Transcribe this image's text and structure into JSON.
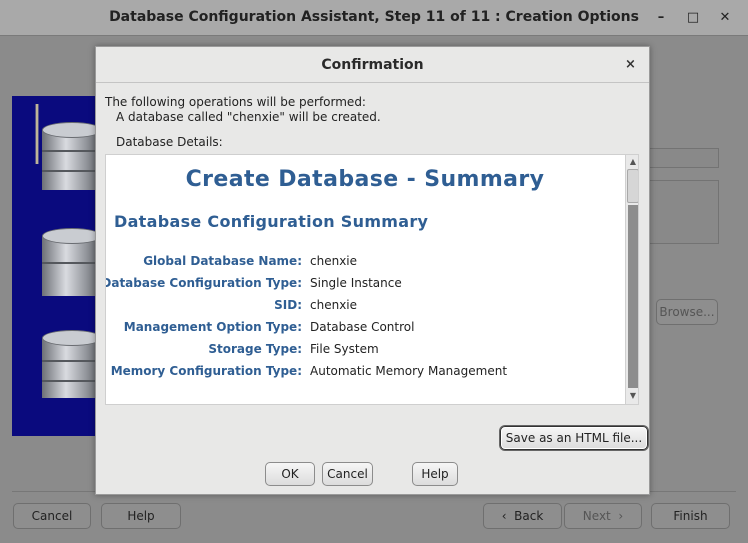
{
  "window": {
    "title": "Database Configuration Assistant, Step 11 of 11 : Creation Options",
    "minimize_glyph": "–",
    "maximize_glyph": "□",
    "close_glyph": "✕"
  },
  "background": {
    "browse_label": "Browse...",
    "footer": {
      "cancel_label": "Cancel",
      "help_label": "Help",
      "back_label": "Back",
      "next_label": "Next",
      "finish_label": "Finish"
    }
  },
  "dialog": {
    "title": "Confirmation",
    "close_glyph": "×",
    "intro_line": "The following operations will be performed:",
    "operation_line": "A database called \"chenxie\" will be created.",
    "details_label": "Database Details:",
    "summary": {
      "heading": "Create Database - Summary",
      "subheading": "Database Configuration Summary",
      "rows": [
        {
          "key": "Global Database Name:",
          "value": "chenxie"
        },
        {
          "key": "Database Configuration Type:",
          "value": "Single Instance"
        },
        {
          "key": "SID:",
          "value": "chenxie"
        },
        {
          "key": "Management Option Type:",
          "value": "Database Control"
        },
        {
          "key": "Storage Type:",
          "value": "File System"
        },
        {
          "key": "Memory Configuration Type:",
          "value": "Automatic Memory Management"
        }
      ]
    },
    "save_html_label": "Save as an HTML file...",
    "ok_label": "OK",
    "cancel_label": "Cancel",
    "help_label": "Help"
  },
  "colors": {
    "summary_text": "#2f5e93",
    "side_panel": "#0a0a7e",
    "dim_background": "#8b8b8b"
  }
}
